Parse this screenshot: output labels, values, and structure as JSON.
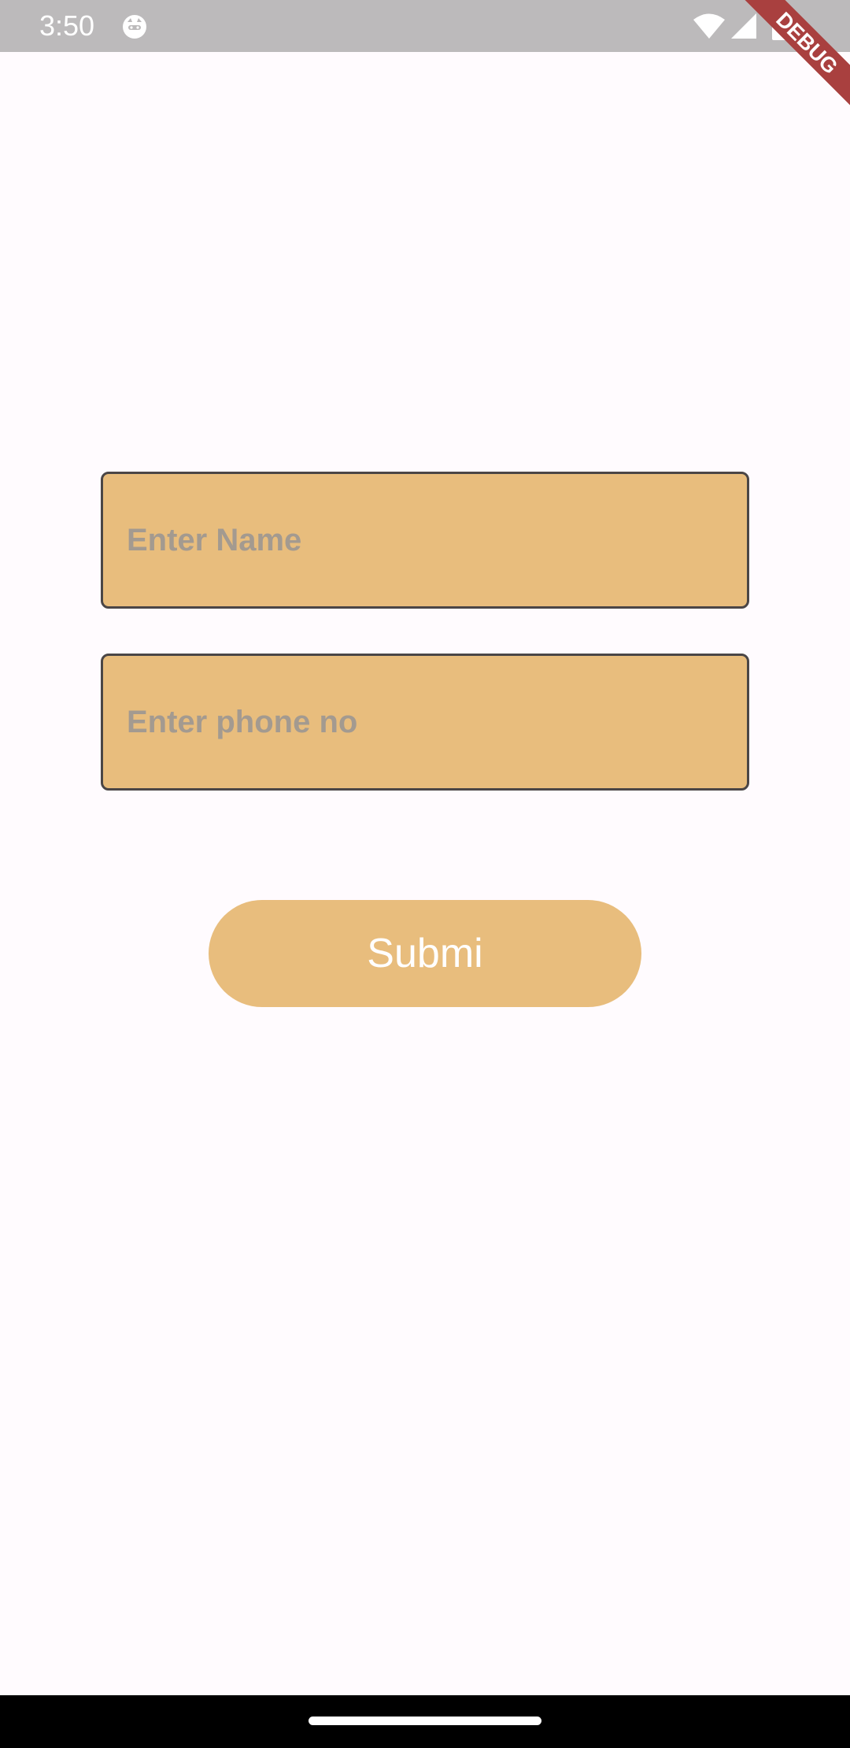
{
  "status_bar": {
    "time": "3:50",
    "icons": [
      "face-icon",
      "wifi-icon",
      "signal-icon",
      "battery-icon"
    ]
  },
  "debug_banner": {
    "label": "DEBUG",
    "color": "#a9403f"
  },
  "form": {
    "name_placeholder": "Enter Name",
    "name_value": "",
    "phone_placeholder": "Enter phone no",
    "phone_value": "",
    "submit_label": "Submi"
  },
  "colors": {
    "background": "#fffbfe",
    "field_fill": "#e8bd7d",
    "field_border": "#4a4646",
    "button_fill": "#e8bd7d",
    "button_text": "#ffffff",
    "status_bar": "#bcbabb"
  }
}
